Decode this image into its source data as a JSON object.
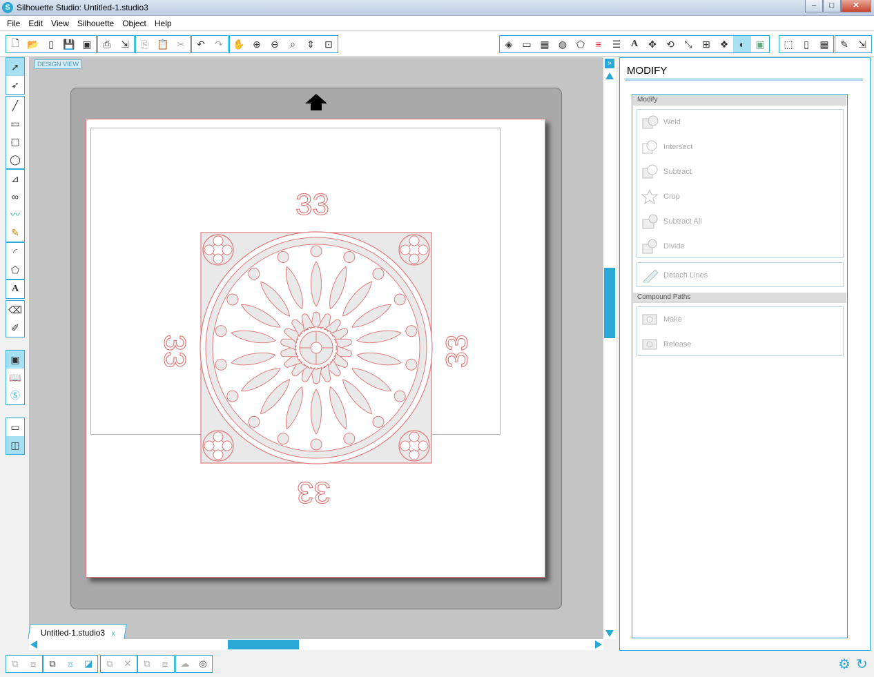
{
  "window": {
    "title": "Silhouette Studio: Untitled-1.studio3",
    "min_label": "–",
    "max_label": "□",
    "close_label": "✕"
  },
  "menu": [
    "File",
    "Edit",
    "View",
    "Silhouette",
    "Object",
    "Help"
  ],
  "design_view_label": "DESIGN VIEW",
  "doc_tab": {
    "name": "Untitled-1.studio3",
    "close": "x"
  },
  "design": {
    "numbers": [
      "33",
      "33",
      "33",
      "33"
    ],
    "line_color": "#e07a7a",
    "fill_color": "#e9e9e9"
  },
  "panel": {
    "title": "MODIFY",
    "sections": {
      "modify": "Modify",
      "compound": "Compound Paths"
    },
    "modify_items": [
      "Weld",
      "Intersect",
      "Subtract",
      "Crop",
      "Subtract All",
      "Divide"
    ],
    "detach_label": "Detach Lines",
    "compound_items": [
      "Make",
      "Release"
    ]
  },
  "colors": {
    "accent": "#2aa9d6",
    "selected": "#a7dff3",
    "workspace": "#c4c4c4",
    "mat": "#a9a9a9"
  }
}
